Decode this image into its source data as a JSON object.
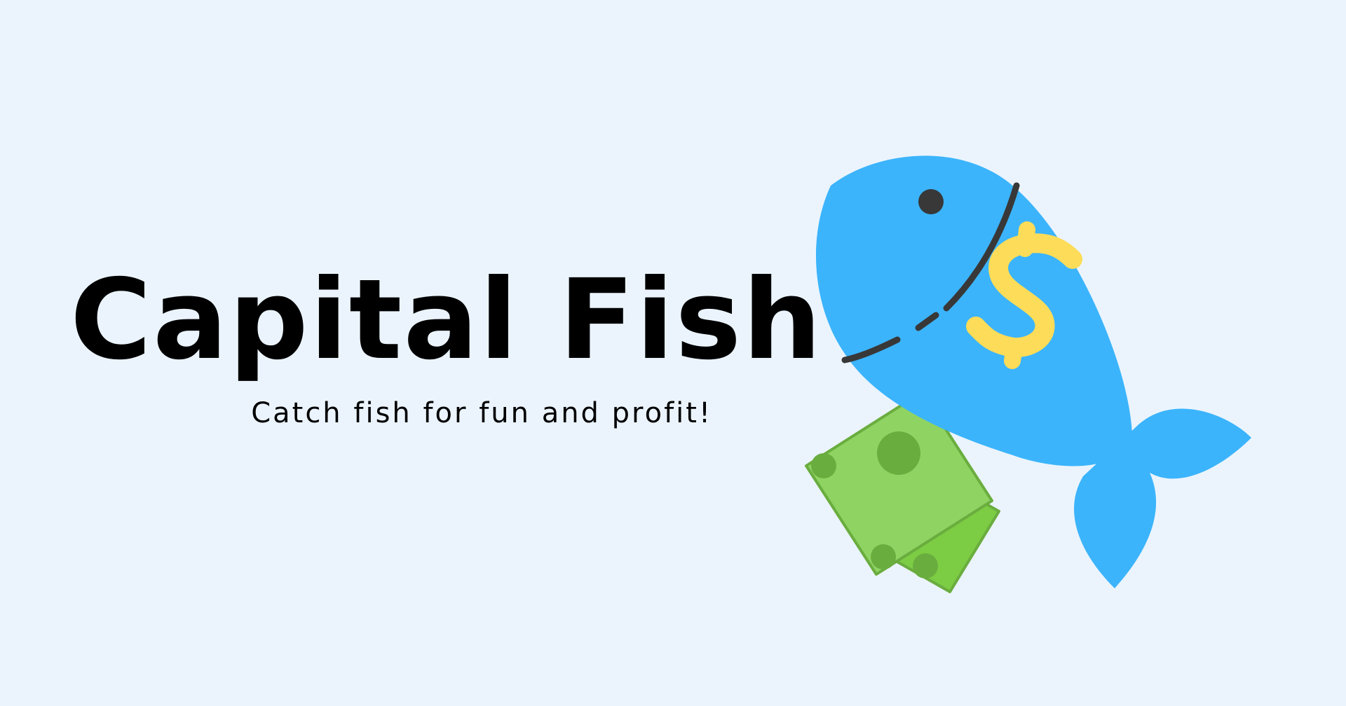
{
  "hero": {
    "title": "Capital Fish",
    "tagline": "Catch fish for fun and profit!"
  },
  "illustration": {
    "icon": "fish-with-money-icon",
    "colors": {
      "fish": "#3bb4fc",
      "fish_line": "#383838",
      "dollar": "#fcdc58",
      "bill_light": "#8fd362",
      "bill_dark": "#7ccc44",
      "bill_shade": "#6aad3f"
    }
  }
}
